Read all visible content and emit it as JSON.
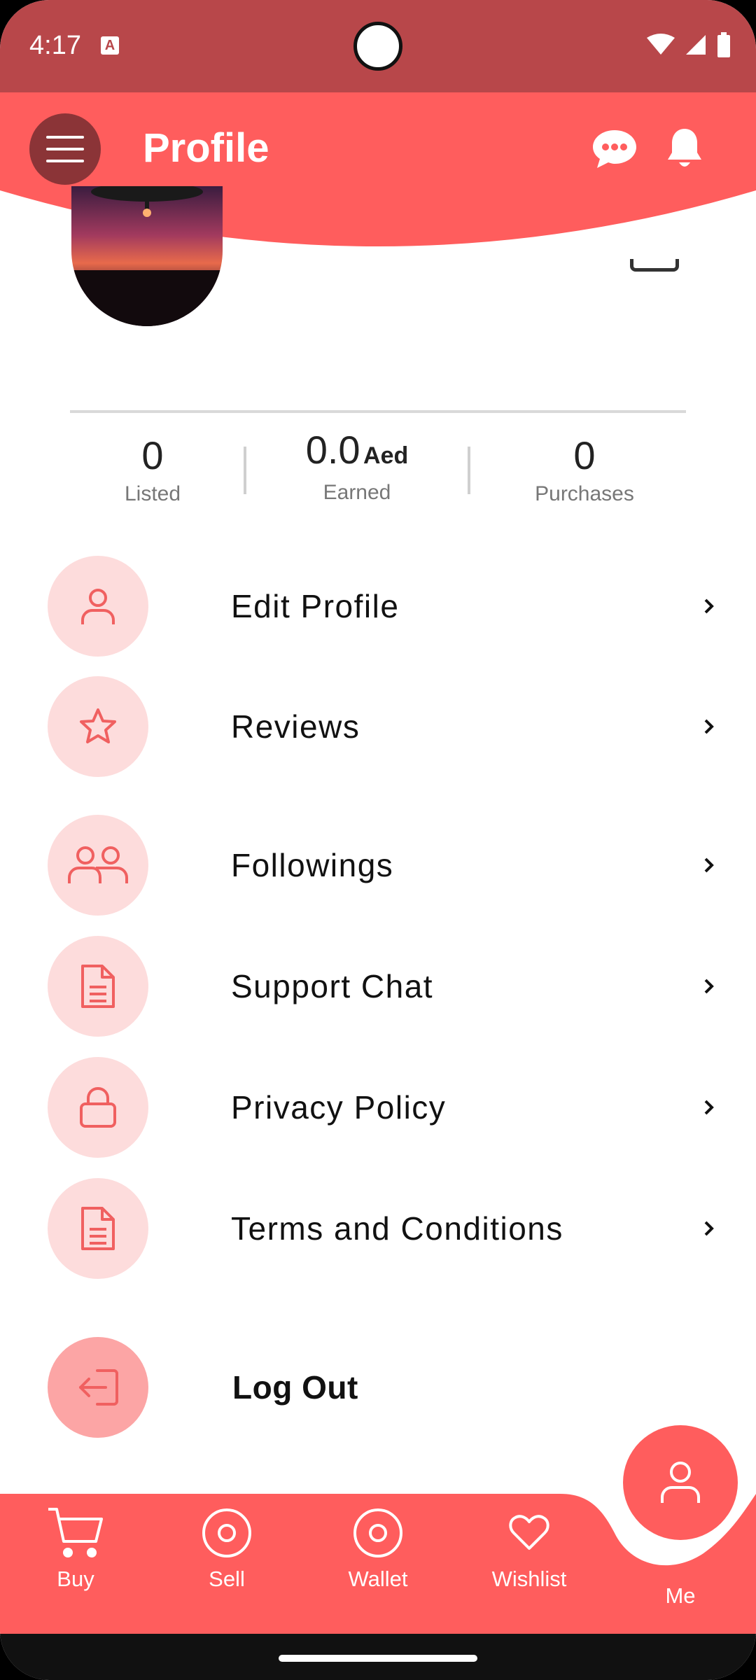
{
  "status_bar": {
    "time": "4:17",
    "notification_icon": "A",
    "icons": [
      "wifi-icon",
      "signal-icon",
      "battery-icon"
    ]
  },
  "header": {
    "title": "Profile",
    "menu_icon": "hamburger-icon",
    "chat_icon": "chat-bubble-icon",
    "bell_icon": "bell-icon"
  },
  "stats": [
    {
      "value": "0",
      "unit": "",
      "label": "Listed"
    },
    {
      "value": "0.0",
      "unit": "Aed",
      "label": "Earned"
    },
    {
      "value": "0",
      "unit": "",
      "label": "Purchases"
    }
  ],
  "menu": {
    "items": [
      {
        "label": "Edit Profile",
        "icon": "user-icon"
      },
      {
        "label": "Reviews",
        "icon": "star-icon"
      },
      {
        "label": "Followings",
        "icon": "users-icon"
      },
      {
        "label": "Support Chat",
        "icon": "document-icon"
      },
      {
        "label": "Privacy Policy",
        "icon": "lock-icon"
      },
      {
        "label": "Terms and Conditions",
        "icon": "document-icon"
      }
    ],
    "logout_label": "Log Out"
  },
  "bottom_nav": {
    "items": [
      {
        "label": "Buy",
        "icon": "cart-icon"
      },
      {
        "label": "Sell",
        "icon": "target-icon"
      },
      {
        "label": "Wallet",
        "icon": "target-icon"
      },
      {
        "label": "Wishlist",
        "icon": "heart-icon"
      },
      {
        "label": "Me",
        "icon": "user-icon"
      }
    ]
  },
  "colors": {
    "accent": "#ff5d5d",
    "status_bar": "#b8474a",
    "icon_bg": "#fddcdc",
    "logout_bg": "#fca5a5"
  }
}
